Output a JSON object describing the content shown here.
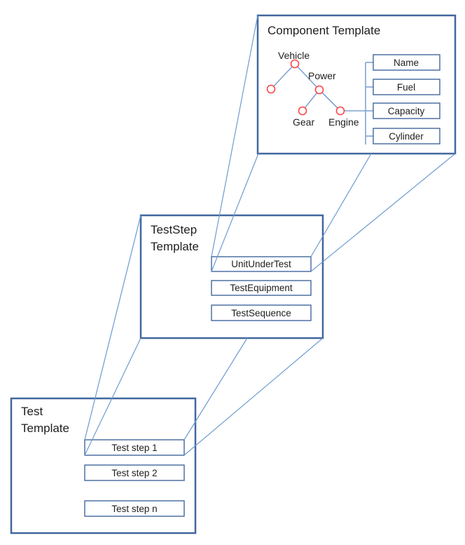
{
  "component_template": {
    "title": "Component Template",
    "tree": {
      "nodes": [
        {
          "id": "vehicle",
          "label": "Vehicle"
        },
        {
          "id": "unnamed",
          "label": ""
        },
        {
          "id": "power",
          "label": "Power"
        },
        {
          "id": "gear",
          "label": "Gear"
        },
        {
          "id": "engine",
          "label": "Engine"
        }
      ],
      "edges": [
        [
          "vehicle",
          "unnamed"
        ],
        [
          "vehicle",
          "power"
        ],
        [
          "power",
          "gear"
        ],
        [
          "power",
          "engine"
        ]
      ]
    },
    "attributes": [
      "Name",
      "Fuel",
      "Capacity",
      "Cylinder"
    ]
  },
  "teststep_template": {
    "title_line1": "TestStep",
    "title_line2": "Template",
    "items": [
      "UnitUnderTest",
      "TestEquipment",
      "TestSequence"
    ]
  },
  "test_template": {
    "title_line1": "Test",
    "title_line2": "Template",
    "items": [
      "Test step 1",
      "Test step 2",
      "Test step n"
    ]
  },
  "colors": {
    "frame": "#41679e",
    "link": "#6e9bd0",
    "node": "#ff4545"
  }
}
